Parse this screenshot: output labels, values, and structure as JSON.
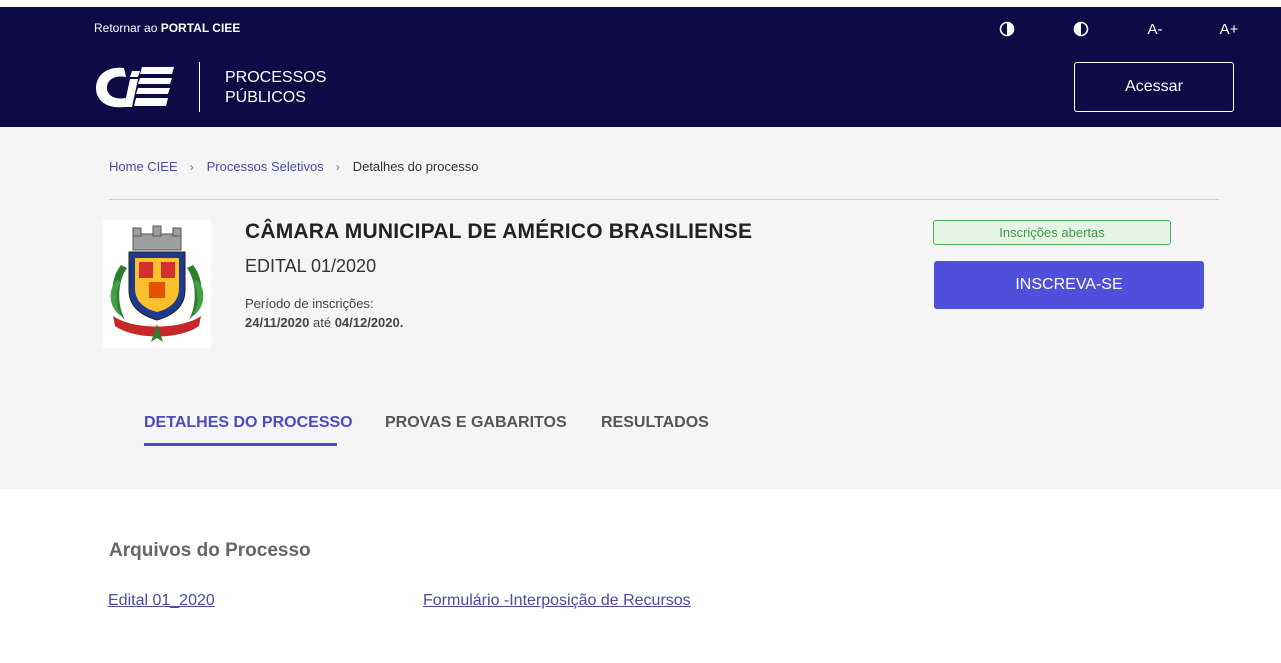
{
  "header": {
    "return_prefix": "Retornar ao",
    "return_bold": "PORTAL CIEE",
    "logo_text_line1": "PROCESSOS",
    "logo_text_line2": "PÚBLICOS",
    "font_decrease_label": "A-",
    "font_increase_label": "A+",
    "login_label": "Acessar",
    "background_color": "#0d0a45"
  },
  "breadcrumb": {
    "items": [
      "Home CIEE",
      "Processos Seletivos"
    ],
    "current": "Detalhes do processo"
  },
  "process": {
    "org_name": "CÂMARA MUNICIPAL DE AMÉRICO BRASILIENSE",
    "edital": "EDITAL 01/2020",
    "period_label": "Período de inscrições:",
    "start_date": "24/11/2020",
    "date_connector": "até",
    "end_date": "04/12/2020.",
    "status": "Inscrições abertas",
    "subscribe_label": "INSCREVA-SE",
    "accent_color": "#4f4fdb"
  },
  "tabs": [
    {
      "label": "DETALHES DO PROCESSO",
      "active": true
    },
    {
      "label": "PROVAS E GABARITOS",
      "active": false
    },
    {
      "label": "RESULTADOS",
      "active": false
    }
  ],
  "files": {
    "title": "Arquivos do Processo",
    "items": [
      "Edital 01_2020",
      "Formulário -Interposição de Recursos"
    ]
  }
}
